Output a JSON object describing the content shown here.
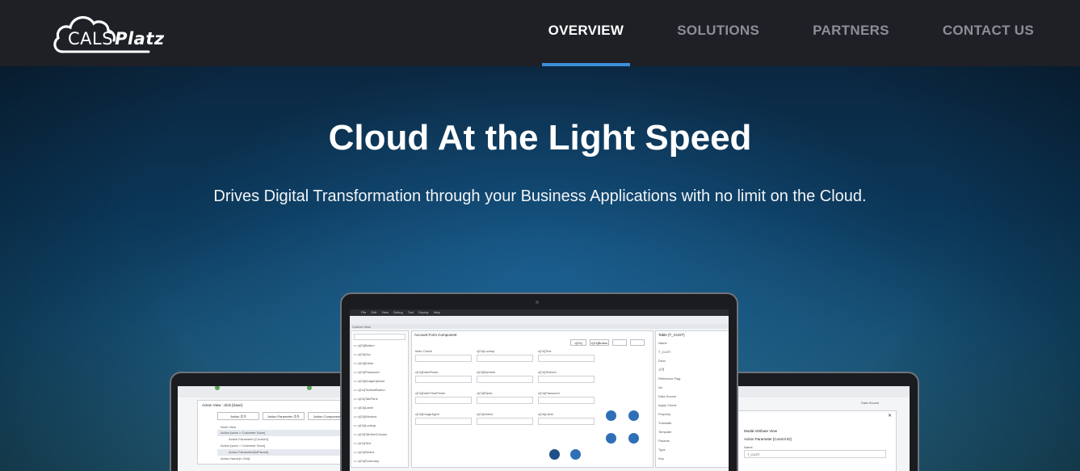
{
  "brand": {
    "logo_main": "CALS",
    "logo_accent": "Platz"
  },
  "nav": {
    "items": [
      {
        "label": "OVERVIEW",
        "active": true
      },
      {
        "label": "SOLUTIONS",
        "active": false
      },
      {
        "label": "PARTNERS",
        "active": false
      },
      {
        "label": "CONTACT US",
        "active": false
      }
    ]
  },
  "hero": {
    "title": "Cloud At the Light Speed",
    "subtitle": "Drives Digital Transformation through your Business Applications with no limit on the Cloud."
  },
  "colors": {
    "nav_bg": "#1e2026",
    "nav_active_underline": "#3b8fd9",
    "nav_inactive_text": "#8c8f96",
    "hero_bg": "#0b3657"
  },
  "mockups": {
    "left_screen": {
      "dialog_title": "Action View : click [Save]",
      "buttons": [
        "Action 추가",
        "Action Parameter 추가",
        "Action Component 추가"
      ],
      "tree_header": "Node View",
      "tree_items": [
        "Action [save > Customer Save]",
        "Action Parameter [Control1]",
        "Action [save > Customer Save]",
        "Action Parameter[intParam]",
        "Action Name(n.Grid)"
      ]
    },
    "center_screen": {
      "menu": [
        "File",
        "Edit",
        "View",
        "Debug",
        "Tool",
        "Deploy",
        "Help"
      ],
      "panel_title": "Control View",
      "form_title": "Account Form Component",
      "field_labels": [
        "Main Check",
        "c[Ck]Lookup",
        "c[Ck]Text",
        "c[Ck]DatePicker",
        "c[Ck]Number",
        "c[Ck]Textbox",
        "c[Ck]DateTimePicker",
        "c[Ck]Radio",
        "c[Ck]Password",
        "c[Ck]Image&grid",
        "c[Ck]Select",
        "c[Ck]Label"
      ],
      "side_items": [
        "c[Ck]Button",
        "c[Ck]Grp",
        "c[Ck]Editor",
        "c[Ck]Password",
        "c[Ck]ImageUpload",
        "c[Ck]ToolbarButton",
        "c[Ck]TabPane",
        "c[Ck]Label",
        "c[Ck]Window",
        "c[Ck]Lookup",
        "c[Ck]TabSubColumn",
        "c[Ck]Text",
        "c[Ck]Select",
        "c[Ck]Summary"
      ],
      "right_panel_title": "Table (T_CUST)",
      "right_labels": [
        "Name",
        "T_CUST",
        "Desc",
        "고객",
        "Reference Flag",
        "No",
        "Data Source",
        "Apply Check",
        "Property",
        "Translate",
        "Template",
        "Params",
        "Type",
        "Key"
      ]
    },
    "right_screen": {
      "dialog_title": "Modal Attribute View",
      "subtitle": "Action Parameter [Control ID]",
      "field_label": "Name",
      "field_value": "T_CUST",
      "side_label": "Data Source"
    }
  }
}
